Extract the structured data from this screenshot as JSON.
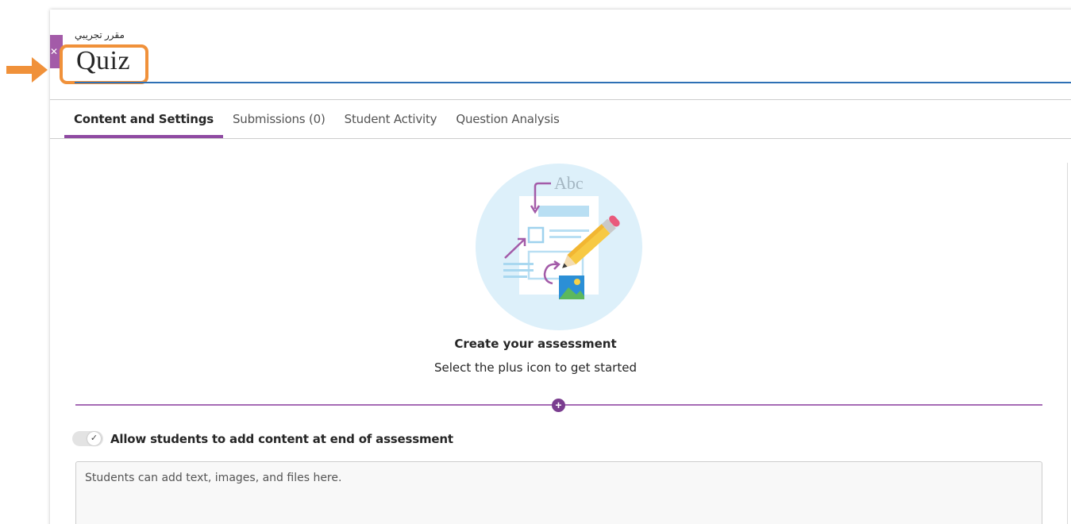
{
  "course": {
    "name": "مقرر تجريبي"
  },
  "page": {
    "title": "Quiz"
  },
  "tabs": [
    {
      "label": "Content and Settings",
      "active": true
    },
    {
      "label": "Submissions (0)",
      "active": false
    },
    {
      "label": "Student Activity",
      "active": false
    },
    {
      "label": "Question Analysis",
      "active": false
    }
  ],
  "illustration": {
    "text": "Abc"
  },
  "empty_state": {
    "title": "Create your assessment",
    "subtitle": "Select the plus icon to get started"
  },
  "add_button": {
    "icon": "plus-circle-icon"
  },
  "toggle": {
    "label": "Allow students to add content at end of assessment",
    "on": true
  },
  "student_content": {
    "placeholder": "Students can add text, images, and files here."
  },
  "colors": {
    "accent_purple": "#8f4aa2",
    "title_rule_blue": "#2e70b5",
    "annotation_orange": "#f0913a"
  }
}
